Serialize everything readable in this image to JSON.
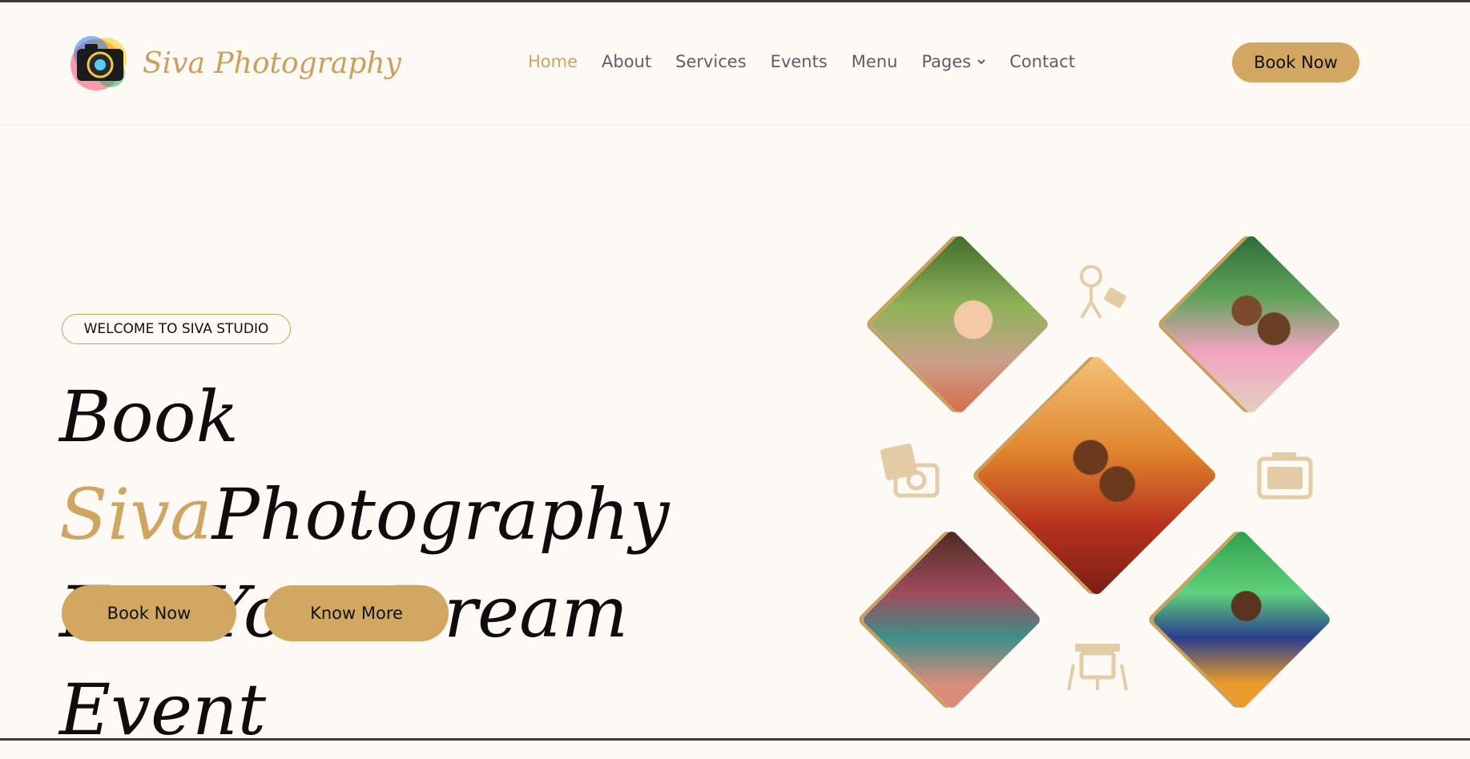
{
  "brand": {
    "name": "Siva Photography"
  },
  "nav": {
    "items": [
      "Home",
      "About",
      "Services",
      "Events",
      "Menu",
      "Pages",
      "Contact"
    ],
    "active": "Home"
  },
  "header": {
    "book_label": "Book Now"
  },
  "hero": {
    "badge": "WELCOME TO SIVA STUDIO",
    "title_line1_pre": "Book ",
    "title_line1_accent": "Siva",
    "title_line1_post": "Photography",
    "title_line2": "For Your Dream Event",
    "book_label": "Book Now",
    "know_label": "Know More"
  },
  "gallery": {
    "photos": [
      "girl-portrait-photo",
      "couple-portrait-photo",
      "wedding-couple-photo",
      "group-celebration-photo",
      "couple-garland-photo"
    ],
    "icons": [
      "studio-light-icon",
      "photo-camera-icon",
      "film-camera-icon",
      "projector-icon"
    ]
  },
  "colors": {
    "accent": "#d2a762",
    "background": "#fdf9f4",
    "text": "#0d0d0d",
    "nav": "#5b5f66"
  }
}
